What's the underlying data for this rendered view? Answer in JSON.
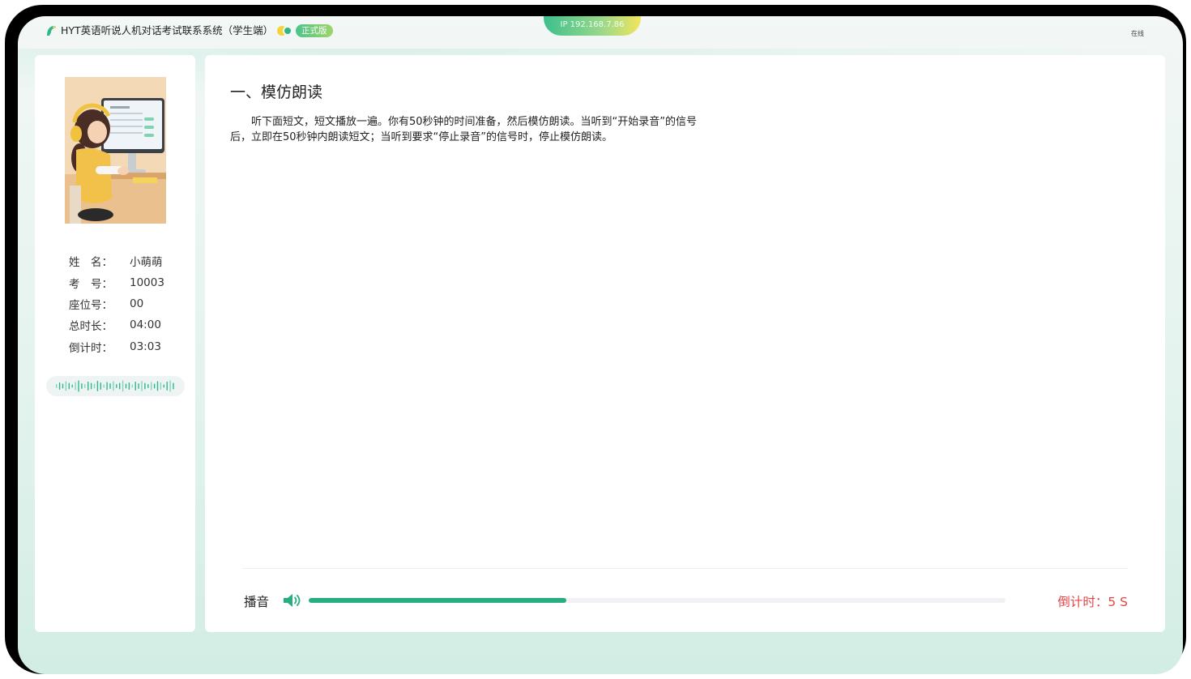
{
  "header": {
    "app_title": "HYT英语听说人机对话考试联系系统（学生端）",
    "edition_badge": "正式版",
    "ip_label": "IP 192.168.7.86",
    "status_label": "在线"
  },
  "student": {
    "fields": [
      {
        "label": "姓　名：",
        "value": "小萌萌"
      },
      {
        "label": "考　号：",
        "value": "10003"
      },
      {
        "label": "座位号：",
        "value": "00"
      },
      {
        "label": "总时长：",
        "value": "04:00"
      },
      {
        "label": "倒计时：",
        "value": "03:03"
      }
    ]
  },
  "question": {
    "section_title": "一、模仿朗读",
    "instructions": "听下面短文，短文播放一遍。你有50秒钟的时间准备，然后模仿朗读。当听到“开始录音”的信号后，立即在50秒钟内朗读短文；当听到要求“停止录音”的信号时，停止模仿朗读。"
  },
  "playback": {
    "label": "播音",
    "progress_percent": 37,
    "countdown": "倒计时：5 S"
  },
  "colors": {
    "accent": "#27ad7e",
    "countdown": "#e64545",
    "track": "#f0f2f5"
  },
  "icons": {
    "logo": "parrot-logo-icon",
    "speaker": "speaker-icon",
    "waveform": "audio-waveform-icon"
  }
}
